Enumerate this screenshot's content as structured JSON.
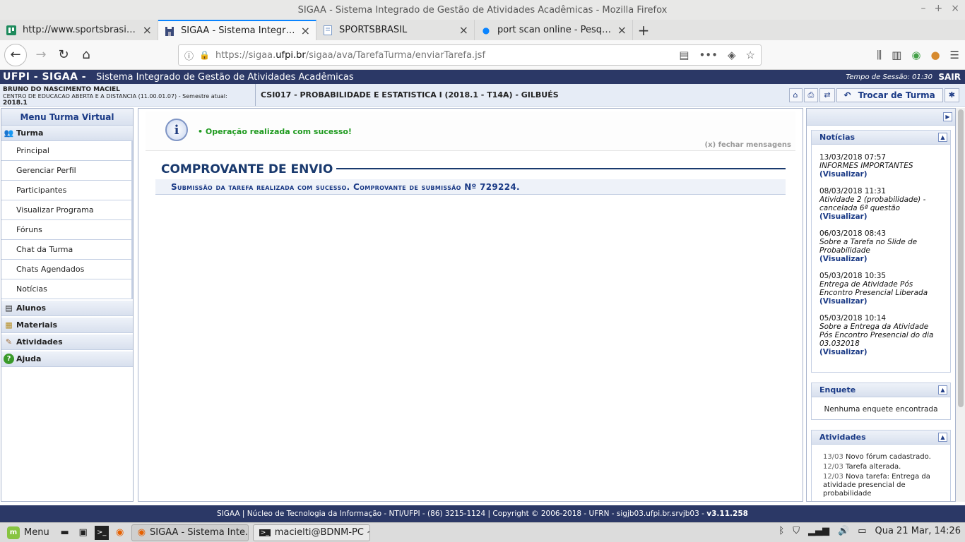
{
  "window": {
    "title": "SIGAA - Sistema Integrado de Gestão de Atividades Acadêmicas - Mozilla Firefox"
  },
  "tabs": [
    {
      "title": "http://www.sportsbrasil.net/ e",
      "icon": "trello-icon",
      "active": false
    },
    {
      "title": "SIGAA - Sistema Integrado de",
      "icon": "castle-icon",
      "active": true
    },
    {
      "title": "SPORTSBRASIL",
      "icon": "page-icon",
      "active": false
    },
    {
      "title": "port scan online - Pesquisa Go",
      "icon": "dot-icon",
      "active": false
    }
  ],
  "urlbar": {
    "prefix": "https://sigaa.",
    "domain": "ufpi.br",
    "path": "/sigaa/ava/TarefaTurma/enviarTarefa.jsf"
  },
  "sigaa": {
    "brand": "UFPI - SIGAA -",
    "system_name": "Sistema Integrado de Gestão de Atividades Acadêmicas",
    "session": "Tempo de Sessão: 01:30",
    "logout": "SAIR"
  },
  "user": {
    "name": "BRUNO DO NASCIMENTO MACIEL",
    "center": "CENTRO DE EDUCACAO ABERTA E A DISTANCIA (11.00.01.07) - Semestre atual:",
    "semester": "2018.1"
  },
  "course": {
    "title": "CSI017 - PROBABILIDADE E ESTATISTICA I (2018.1 - T14A) - GILBUÉS",
    "trocar": "Trocar de Turma"
  },
  "menu": {
    "title": "Menu Turma Virtual",
    "sections": [
      {
        "label": "Turma",
        "items": [
          "Principal",
          "Gerenciar Perfil",
          "Participantes",
          "Visualizar Programa",
          "Fóruns",
          "Chat da Turma",
          "Chats Agendados",
          "Notícias"
        ]
      },
      {
        "label": "Alunos"
      },
      {
        "label": "Materiais"
      },
      {
        "label": "Atividades"
      },
      {
        "label": "Ajuda"
      }
    ]
  },
  "message": {
    "text": "Operação realizada com sucesso!",
    "close": "(x) fechar mensagens"
  },
  "comprovante": {
    "title": "COMPROVANTE DE ENVIO",
    "msg": "Submissão da tarefa realizada com sucesso. Comprovante de submissão Nº 729224."
  },
  "noticias": {
    "title": "Notícias",
    "items": [
      {
        "date": "13/03/2018 07:57",
        "text": "INFORMES IMPORTANTES",
        "link": "(Visualizar)"
      },
      {
        "date": "08/03/2018 11:31",
        "text": "Atividade 2 (probabilidade) - cancelada 6ª questão",
        "link": "(Visualizar)"
      },
      {
        "date": "06/03/2018 08:43",
        "text": "Sobre a Tarefa no Slide de Probabilidade",
        "link": "(Visualizar)"
      },
      {
        "date": "05/03/2018 10:35",
        "text": "Entrega de Atividade Pós Encontro Presencial Liberada",
        "link": "(Visualizar)"
      },
      {
        "date": "05/03/2018 10:14",
        "text": "Sobre a Entrega da Atividade Pós Encontro Presencial do dia 03.032018",
        "link": "(Visualizar)"
      }
    ]
  },
  "enquete": {
    "title": "Enquete",
    "text": "Nenhuma enquete encontrada"
  },
  "atividades": {
    "title": "Atividades",
    "items": [
      {
        "date": "13/03",
        "text": "Novo fórum cadastrado."
      },
      {
        "date": "12/03",
        "text": "Tarefa alterada."
      },
      {
        "date": "12/03",
        "text": "Nova tarefa: Entrega da atividade presencial de probabilidade"
      }
    ]
  },
  "footer": {
    "text": "SIGAA | Núcleo de Tecnologia da Informação - NTI/UFPI - (86) 3215-1124 | Copyright © 2006-2018 - UFRN - sigjb03.ufpi.br.srvjb03 -",
    "version": "v3.11.258"
  },
  "taskbar": {
    "menu": "Menu",
    "windows": [
      {
        "title": "SIGAA - Sistema Inte...",
        "active": true
      },
      {
        "title": "macielti@BDNM-PC ~",
        "active": false
      }
    ],
    "clock": "Qua 21 Mar, 14:26"
  }
}
